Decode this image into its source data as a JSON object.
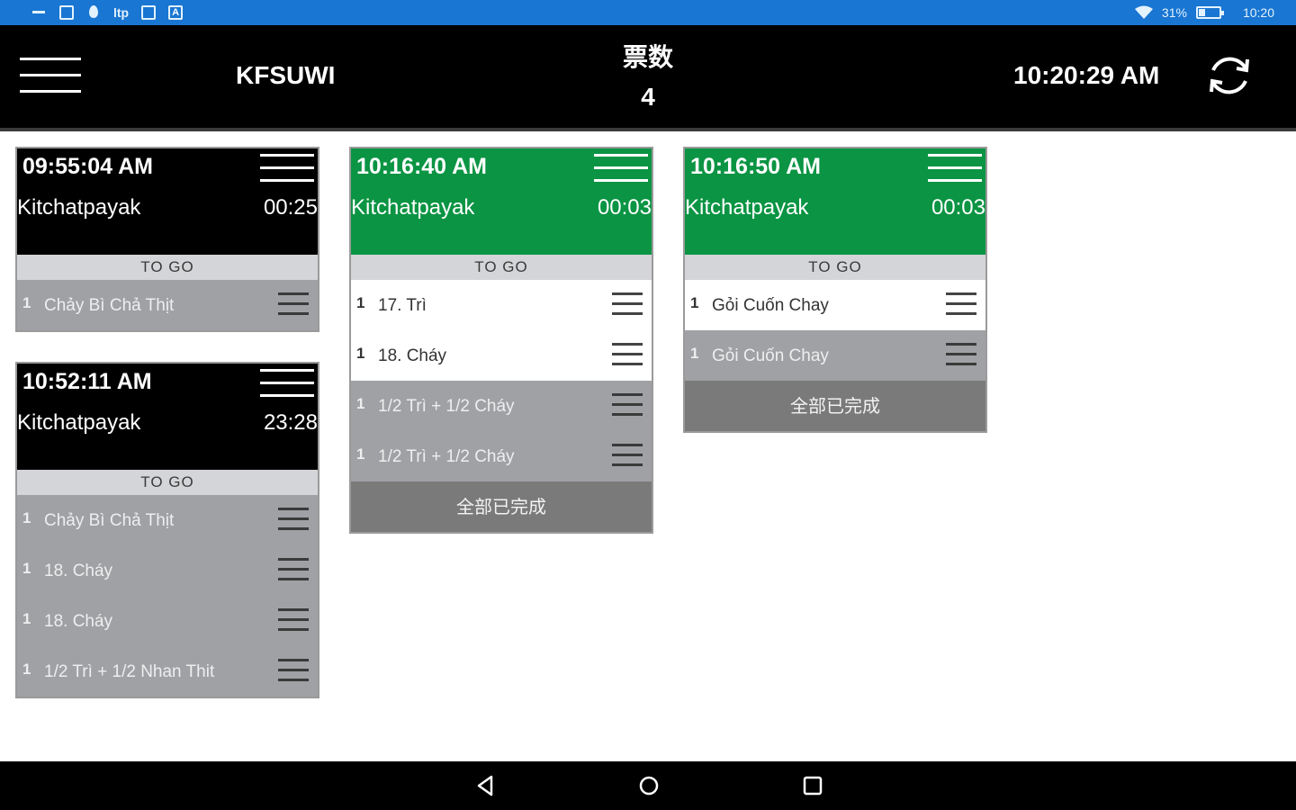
{
  "status_bar": {
    "left_icons": [
      "notification-dash-icon",
      "screen-icon",
      "location-pin-icon",
      "app-icon-ltp",
      "photo-icon",
      "a-icon"
    ],
    "ltp_text": "ltp",
    "a_text": "A",
    "battery": "31%",
    "battery_level": 0.31,
    "time": "10:20"
  },
  "header": {
    "store_name": "KFSUWI",
    "ticket_count_label": "票数",
    "ticket_count": "4",
    "clock": "10:20:29 AM"
  },
  "tickets": [
    {
      "time": "09:55:04 AM",
      "name": "Kitchatpayak",
      "elapsed": "00:25",
      "header_color": "#000000",
      "order_type": "TO GO",
      "items": [
        {
          "qty": "1",
          "name": "Chảy Bì Chả Thịt",
          "done": true
        }
      ],
      "done_label": ""
    },
    {
      "time": "10:52:11 AM",
      "name": "Kitchatpayak",
      "elapsed": "23:28",
      "header_color": "#000000",
      "order_type": "TO GO",
      "items": [
        {
          "qty": "1",
          "name": "Chảy Bì Chả Thịt",
          "done": true
        },
        {
          "qty": "1",
          "name": "18. Cháy",
          "done": true
        },
        {
          "qty": "1",
          "name": "18. Cháy",
          "done": true
        },
        {
          "qty": "1",
          "name": "1/2 Trì + 1/2 Nhan Thit",
          "done": true
        }
      ],
      "done_label": ""
    },
    {
      "time": "10:16:40 AM",
      "name": "Kitchatpayak",
      "elapsed": "00:03",
      "header_color": "#0a9443",
      "order_type": "TO GO",
      "items": [
        {
          "qty": "1",
          "name": "17. Trì",
          "done": false
        },
        {
          "qty": "1",
          "name": "18. Cháy",
          "done": false
        },
        {
          "qty": "1",
          "name": "1/2 Trì + 1/2 Cháy",
          "done": true
        },
        {
          "qty": "1",
          "name": "1/2 Trì + 1/2 Cháy",
          "done": true
        }
      ],
      "done_label": "全部已完成"
    },
    {
      "time": "10:16:50 AM",
      "name": "Kitchatpayak",
      "elapsed": "00:03",
      "header_color": "#0a9443",
      "order_type": "TO GO",
      "items": [
        {
          "qty": "1",
          "name": "Gỏi Cuốn Chay",
          "done": false
        },
        {
          "qty": "1",
          "name": "Gỏi Cuốn Chay",
          "done": true
        }
      ],
      "done_label": "全部已完成"
    }
  ],
  "nav_bar": {
    "buttons": [
      "back-icon",
      "home-icon",
      "recents-icon"
    ]
  }
}
